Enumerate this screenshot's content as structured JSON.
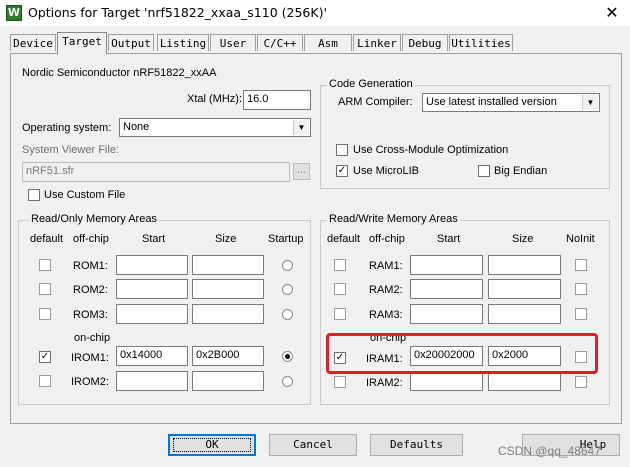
{
  "window": {
    "title": "Options for Target 'nrf51822_xxaa_s110 (256K)'",
    "close_glyph": "✕",
    "icon_glyph": "W"
  },
  "tabs": [
    {
      "label": "Device"
    },
    {
      "label": "Target"
    },
    {
      "label": "Output"
    },
    {
      "label": "Listing"
    },
    {
      "label": "User"
    },
    {
      "label": "C/C++"
    },
    {
      "label": "Asm"
    },
    {
      "label": "Linker"
    },
    {
      "label": "Debug"
    },
    {
      "label": "Utilities"
    }
  ],
  "active_tab": "Target",
  "device_name": "Nordic Semiconductor nRF51822_xxAA",
  "xtal": {
    "label": "Xtal (MHz):",
    "value": "16.0"
  },
  "os": {
    "label": "Operating system:",
    "value": "None"
  },
  "svf": {
    "label": "System Viewer File:",
    "value": "nRF51.sfr",
    "browse": "..."
  },
  "custom_file": {
    "label": "Use Custom File",
    "checked": false
  },
  "codegen": {
    "title": "Code Generation",
    "compiler_label": "ARM Compiler:",
    "compiler_value": "Use latest installed version",
    "cross_module": {
      "label": "Use Cross-Module Optimization",
      "checked": false
    },
    "microlib": {
      "label": "Use MicroLIB",
      "checked": true
    },
    "big_endian": {
      "label": "Big Endian",
      "checked": false
    }
  },
  "rom": {
    "title": "Read/Only Memory Areas",
    "headers": {
      "default": "default",
      "offchip": "off-chip",
      "start": "Start",
      "size": "Size",
      "extra": "Startup"
    },
    "onchip_label": "on-chip",
    "rows": [
      {
        "name": "ROM1:",
        "start": "",
        "size": "",
        "default": false,
        "selected": false
      },
      {
        "name": "ROM2:",
        "start": "",
        "size": "",
        "default": false,
        "selected": false
      },
      {
        "name": "ROM3:",
        "start": "",
        "size": "",
        "default": false,
        "selected": false
      },
      {
        "name": "IROM1:",
        "start": "0x14000",
        "size": "0x2B000",
        "default": true,
        "selected": true
      },
      {
        "name": "IROM2:",
        "start": "",
        "size": "",
        "default": false,
        "selected": false
      }
    ]
  },
  "ram": {
    "title": "Read/Write Memory Areas",
    "headers": {
      "default": "default",
      "offchip": "off-chip",
      "start": "Start",
      "size": "Size",
      "extra": "NoInit"
    },
    "onchip_label": "on-chip",
    "rows": [
      {
        "name": "RAM1:",
        "start": "",
        "size": "",
        "default": false,
        "noinit": false
      },
      {
        "name": "RAM2:",
        "start": "",
        "size": "",
        "default": false,
        "noinit": false
      },
      {
        "name": "RAM3:",
        "start": "",
        "size": "",
        "default": false,
        "noinit": false
      },
      {
        "name": "IRAM1:",
        "start": "0x20002000",
        "size": "0x2000",
        "default": true,
        "noinit": false
      },
      {
        "name": "IRAM2:",
        "start": "",
        "size": "",
        "default": false,
        "noinit": false
      }
    ]
  },
  "buttons": {
    "ok": "OK",
    "cancel": "Cancel",
    "defaults": "Defaults",
    "help": "Help"
  },
  "watermark": "CSDN @qq_48647",
  "check_glyph": "✓",
  "highlight_color": "#e02020"
}
